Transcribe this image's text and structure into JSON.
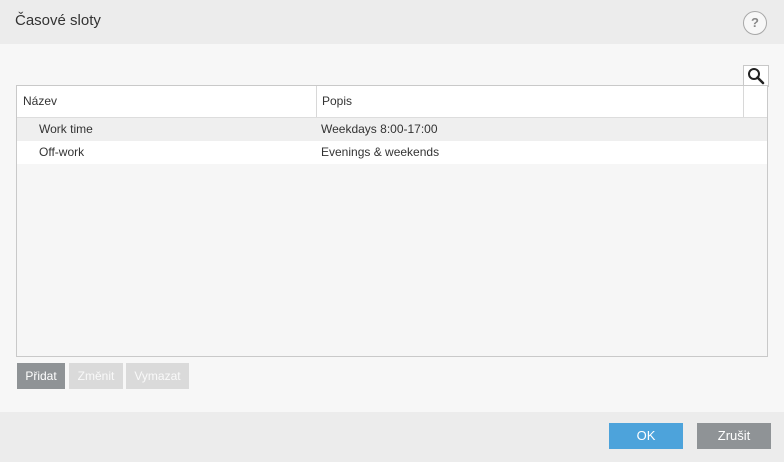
{
  "dialog": {
    "title": "Časové sloty",
    "help_label": "?"
  },
  "icons": {
    "help": "question-circle-icon",
    "search": "magnifier-icon"
  },
  "table": {
    "columns": [
      "Název",
      "Popis"
    ],
    "rows": [
      {
        "name": "Work time",
        "description": "Weekdays 8:00-17:00"
      },
      {
        "name": "Off-work",
        "description": "Evenings & weekends"
      }
    ]
  },
  "actions": {
    "add_label": "Přidat",
    "edit_label": "Změnit",
    "delete_label": "Vymazat"
  },
  "footer": {
    "ok_label": "OK",
    "cancel_label": "Zrušit"
  },
  "colors": {
    "ok_button": "#4da3db",
    "neutral_button": "#8f9396",
    "disabled_button": "#dadada"
  }
}
